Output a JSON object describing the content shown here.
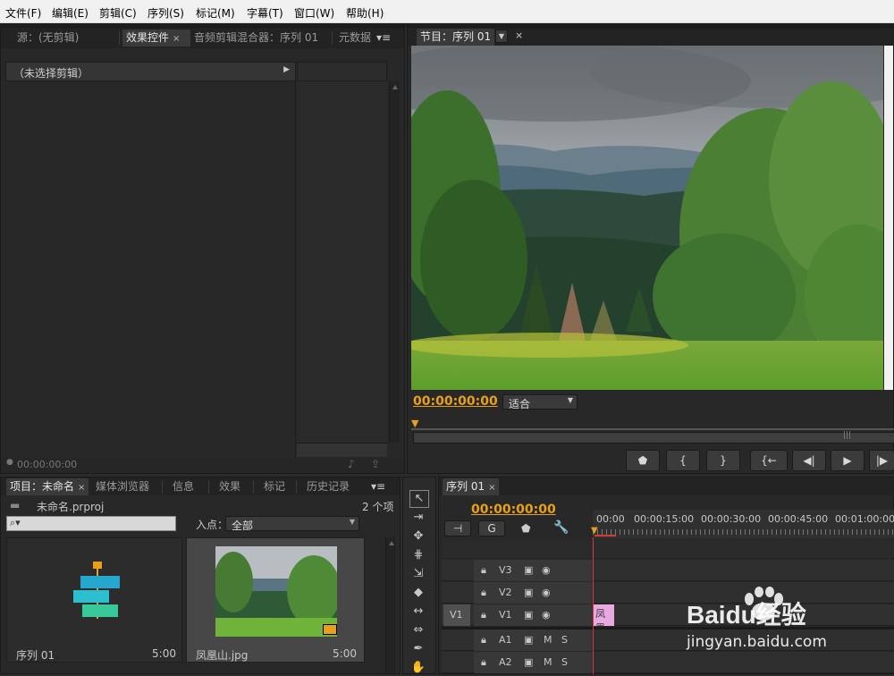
{
  "menu": [
    "文件(F)",
    "编辑(E)",
    "剪辑(C)",
    "序列(S)",
    "标记(M)",
    "字幕(T)",
    "窗口(W)",
    "帮助(H)"
  ],
  "source_panel": {
    "tabs": [
      "源：(无剪辑)",
      "效果控件",
      "音频剪辑混合器：序列 01",
      "元数据"
    ],
    "no_clip": "（未选择剪辑）",
    "timecode": "00:00:00:00"
  },
  "program_panel": {
    "tab": "节目：序列 01",
    "timecode": "00:00:00:00",
    "fit": "适合"
  },
  "project_panel": {
    "tabs": [
      "项目：未命名",
      "媒体浏览器",
      "信息",
      "效果",
      "标记",
      "历史记录"
    ],
    "project_file": "未命名.prproj",
    "item_count": "2 个项",
    "in_point_label": "入点：",
    "in_point_value": "全部",
    "items": [
      {
        "name": "序列 01",
        "duration": "5:00"
      },
      {
        "name": "凤凰山.jpg",
        "duration": "5:00"
      }
    ]
  },
  "timeline": {
    "tab": "序列 01",
    "timecode": "00:00:00:00",
    "ruler": [
      "00:00",
      "00:00:15:00",
      "00:00:30:00",
      "00:00:45:00",
      "00:01:00:00"
    ],
    "tracks": [
      {
        "name": "V3",
        "type": "video"
      },
      {
        "name": "V2",
        "type": "video"
      },
      {
        "name": "V1",
        "type": "video",
        "source": "V1"
      },
      {
        "name": "A1",
        "type": "audio",
        "m": "M",
        "s": "S"
      },
      {
        "name": "A2",
        "type": "audio",
        "m": "M",
        "s": "S"
      }
    ],
    "clip_label": "凤凰"
  },
  "watermark": {
    "brand": "Baidu经验",
    "url": "jingyan.baidu.com"
  },
  "colors": {
    "accent": "#e8a01c",
    "clip": "#e8a8e0",
    "playhead": "#d83a3a"
  }
}
